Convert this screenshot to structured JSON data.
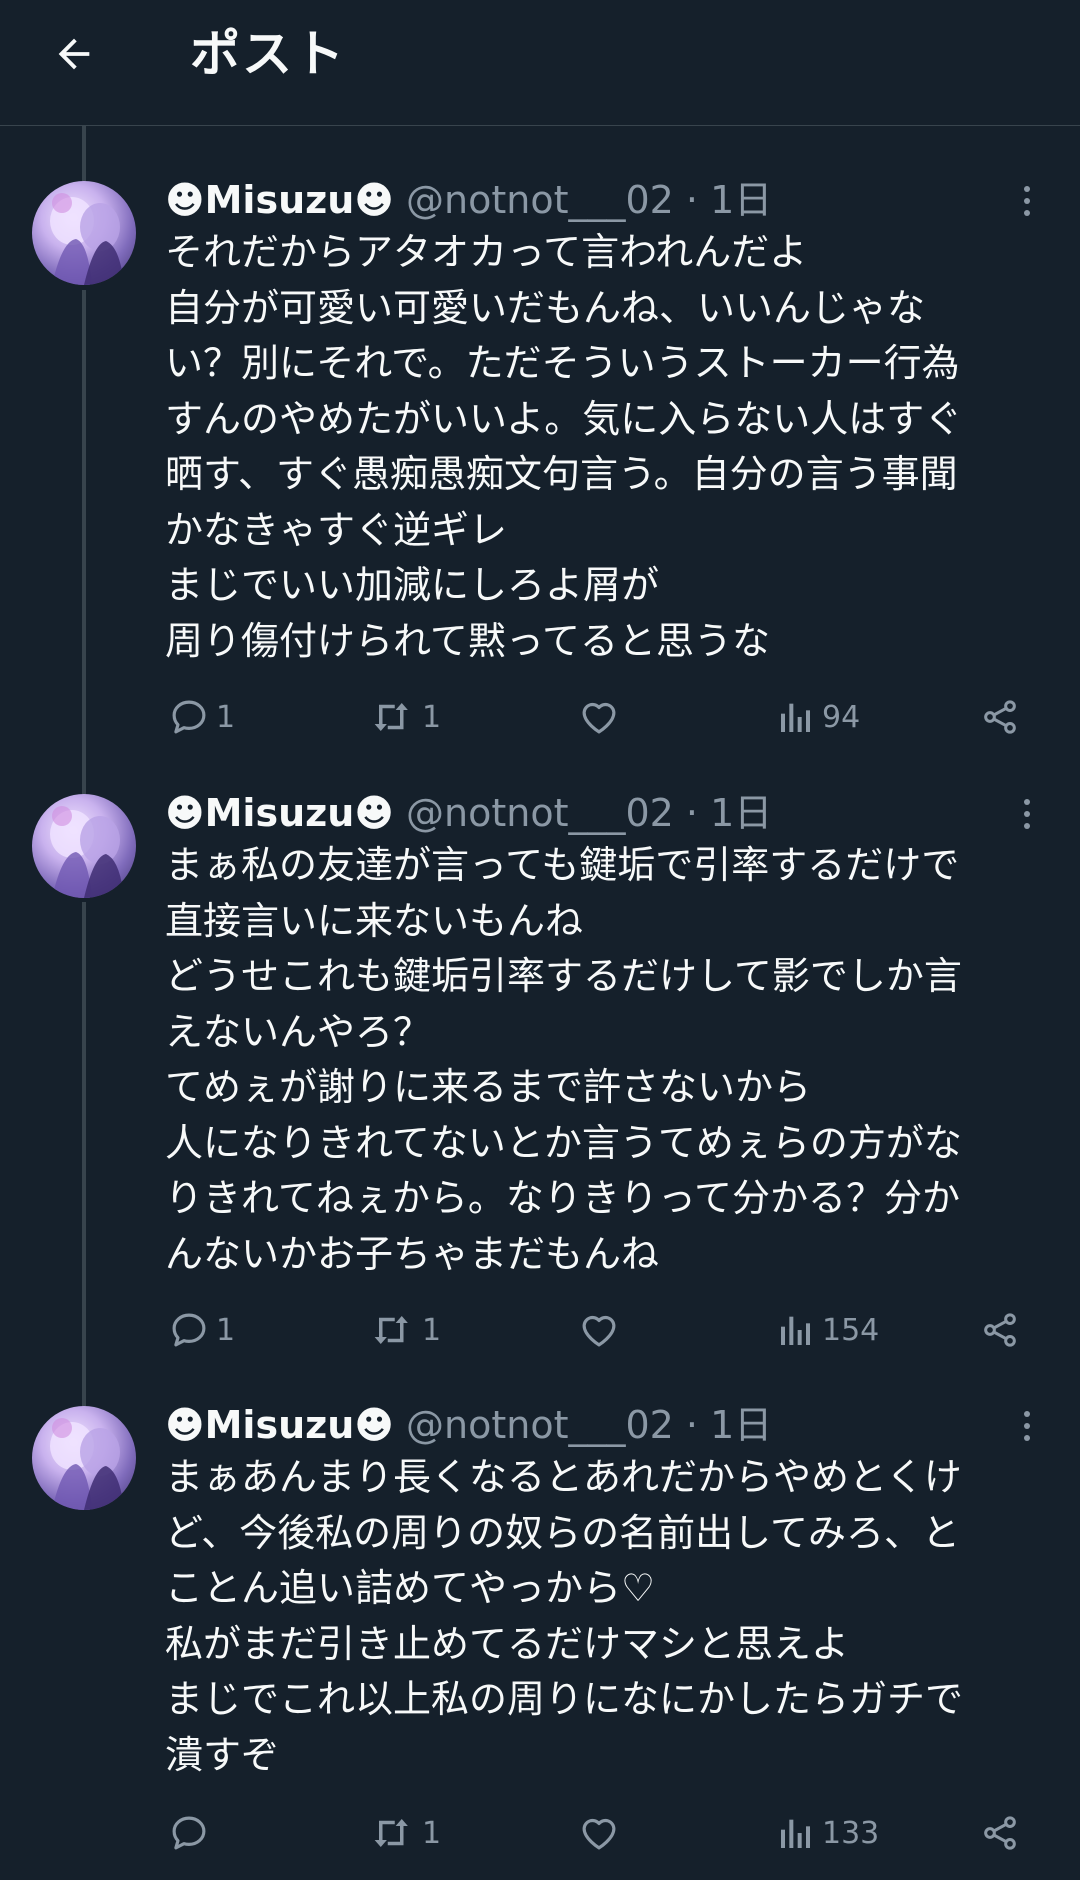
{
  "header": {
    "title": "ポスト",
    "back_icon": "arrow-left-icon"
  },
  "colors": {
    "background": "#15202b",
    "text": "#f7f9f9",
    "muted": "#8b98a5",
    "border": "#38444d"
  },
  "posts": [
    {
      "name": "☻Misuzu☻",
      "handle": "@notnot___02 · 1日",
      "lines": [
        "それだからアタオカって言われんだよ",
        "自分が可愛い可愛いだもんね、いいんじゃな",
        "い？別にそれで。ただそういうストーカー行為",
        "すんのやめたがいいよ。気に入らない人はすぐ",
        "晒す、すぐ愚痴愚痴文句言う。自分の言う事聞",
        "かなきゃすぐ逆ギレ",
        "まじでいい加減にしろよ屑が",
        "周り傷付けられて黙ってると思うな"
      ],
      "replies": "1",
      "reposts": "1",
      "views": "94"
    },
    {
      "name": "☻Misuzu☻",
      "handle": "@notnot___02 · 1日",
      "lines": [
        "まぁ私の友達が言っても鍵垢で引率するだけで",
        "直接言いに来ないもんね",
        "どうせこれも鍵垢引率するだけして影でしか言",
        "えないんやろ？",
        "てめぇが謝りに来るまで許さないから",
        "人になりきれてないとか言うてめぇらの方がな",
        "りきれてねぇから。なりきりって分かる？分か",
        "んないかお子ちゃまだもんね"
      ],
      "replies": "1",
      "reposts": "1",
      "views": "154"
    },
    {
      "name": "☻Misuzu☻",
      "handle": "@notnot___02 · 1日",
      "lines": [
        "まぁあんまり長くなるとあれだからやめとくけ",
        "ど、今後私の周りの奴らの名前出してみろ、と",
        "ことん追い詰めてやっから♡",
        "私がまだ引き止めてるだけマシと思えよ",
        "まじでこれ以上私の周りになにかしたらガチで",
        "潰すぞ"
      ],
      "replies": "",
      "reposts": "1",
      "views": "133"
    }
  ]
}
